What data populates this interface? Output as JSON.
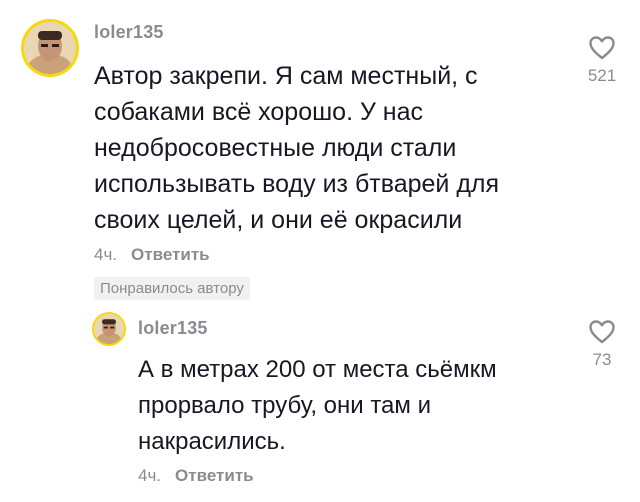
{
  "comments": [
    {
      "username": "loler135",
      "text": "Автор закрепи. Я сам местный, с\nсобаками всё хорошо. У нас\nнедобросовестные люди стали\nиспользывать воду из бтварей для\nсвоих целей, и они её окрасили",
      "time": "4ч.",
      "reply_label": "Ответить",
      "badge": "Понравилось автору",
      "likes": "521",
      "like_icon": "heart-outline-icon"
    },
    {
      "username": "loler135",
      "text": "А в метрах 200 от места сьёмкм\nпрорвало трубу, они там и\nнакрасились.",
      "time": "4ч.",
      "reply_label": "Ответить",
      "likes": "73",
      "like_icon": "heart-outline-icon"
    }
  ],
  "colors": {
    "text": "#161823",
    "muted": "#8a8b91",
    "badge_bg": "#f1f1f2",
    "avatar_ring": "#f5d90a"
  }
}
